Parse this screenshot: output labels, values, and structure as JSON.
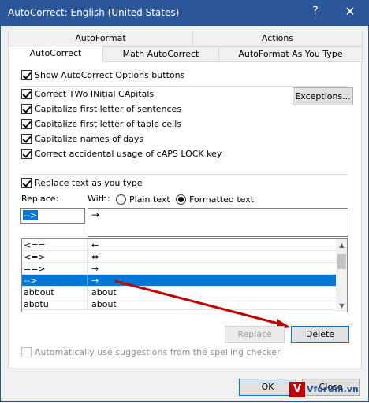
{
  "window": {
    "title": "AutoCorrect: English (United States)",
    "help": "?",
    "close": "✕"
  },
  "tabs": {
    "row1": [
      "AutoFormat",
      "Actions"
    ],
    "row2": [
      "AutoCorrect",
      "Math AutoCorrect",
      "AutoFormat As You Type"
    ]
  },
  "options": {
    "show_buttons": "Show AutoCorrect Options buttons",
    "two_initials": "Correct TWo INitial CApitals",
    "first_sentence": "Capitalize first letter of sentences",
    "first_table": "Capitalize first letter of table cells",
    "days": "Capitalize names of days",
    "caps_lock": "Correct accidental usage of cAPS LOCK key",
    "exceptions": "Exceptions..."
  },
  "replace": {
    "group_label": "Replace text as you type",
    "replace_label": "Replace:",
    "with_label": "With:",
    "plain": "Plain text",
    "formatted": "Formatted text",
    "replace_value": "-->",
    "with_value": "→"
  },
  "list": {
    "rows": [
      {
        "replace": "<==",
        "with": "←"
      },
      {
        "replace": "<=>",
        "with": "⇔"
      },
      {
        "replace": "==>",
        "with": "→"
      },
      {
        "replace": "-->",
        "with": "→"
      },
      {
        "replace": "abbout",
        "with": "about"
      },
      {
        "replace": "abotu",
        "with": "about"
      }
    ],
    "selected_index": 3
  },
  "buttons": {
    "replace": "Replace",
    "delete": "Delete",
    "ok": "OK",
    "close": "Close"
  },
  "suggestions": "Automatically use suggestions from the spelling checker",
  "watermark": "VforUm.vn",
  "colors": {
    "accent": "#2b579a",
    "selection": "#0078d7",
    "arrow": "#c00000"
  }
}
